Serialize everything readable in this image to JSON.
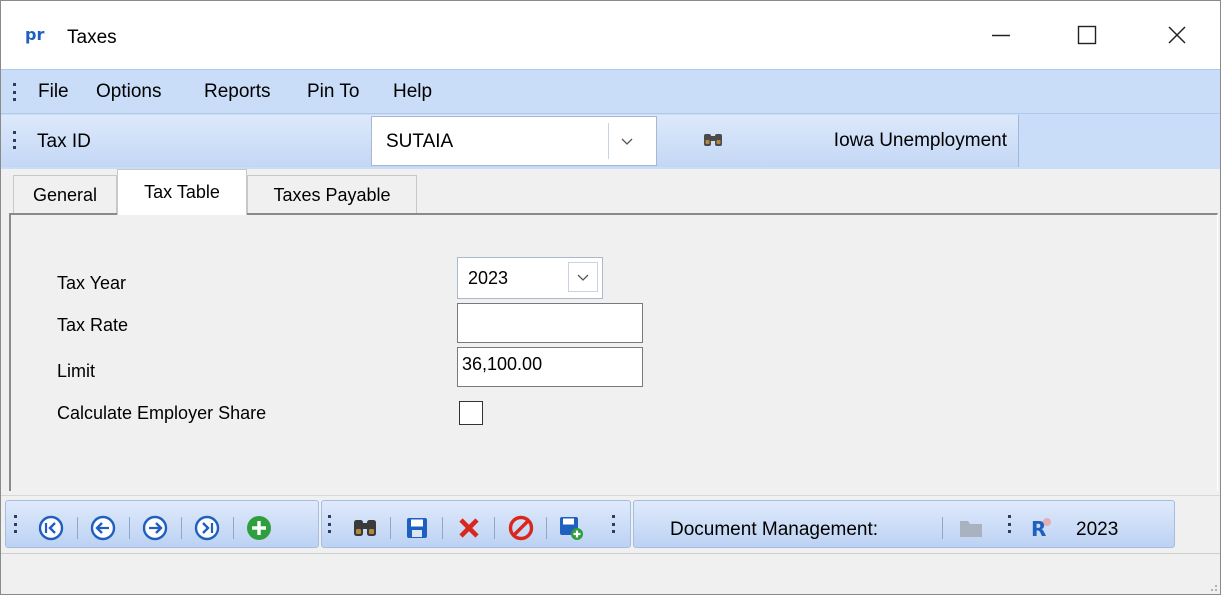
{
  "window": {
    "title": "Taxes",
    "app_icon_text": "pr"
  },
  "menu": [
    "File",
    "Options",
    "Reports",
    "Pin To",
    "Help"
  ],
  "taxbar": {
    "label": "Tax ID",
    "tax_id_value": "SUTAIA",
    "description": "Iowa Unemployment"
  },
  "tabs": [
    {
      "label": "General",
      "active": false
    },
    {
      "label": "Tax Table",
      "active": true
    },
    {
      "label": "Taxes Payable",
      "active": false
    }
  ],
  "form": {
    "tax_year_label": "Tax Year",
    "tax_year_value": "2023",
    "tax_rate_label": "Tax Rate",
    "tax_rate_value": "",
    "limit_label": "Limit",
    "limit_value": "36,100.00",
    "employer_share_label": "Calculate Employer Share",
    "employer_share_checked": false
  },
  "toolbar": {
    "buttons": [
      "first-record-icon",
      "previous-record-icon",
      "next-record-icon",
      "last-record-icon",
      "add-record-icon",
      "find-icon",
      "save-icon",
      "delete-icon",
      "cancel-icon",
      "save-new-icon"
    ],
    "document_management_label": "Document Management:",
    "year_label": "2023"
  },
  "colors": {
    "toolbar_blue": "#c9dcf8",
    "nav_icon_blue": "#1f5fbf",
    "add_green": "#2e9e3e",
    "delete_red": "#d9271e"
  }
}
